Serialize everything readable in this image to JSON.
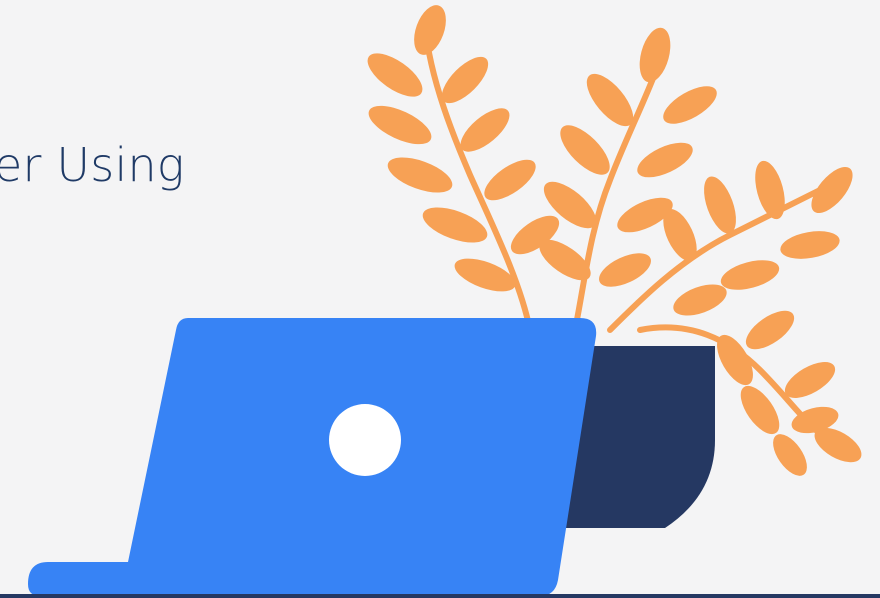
{
  "hero": {
    "heading_fragment": "er Using"
  },
  "colors": {
    "background": "#f4f4f5",
    "heading": "#1f3a66",
    "laptop": "#3783f5",
    "laptop_logo": "#ffffff",
    "plant": "#f7a155",
    "pot": "#253862",
    "floor_line": "#253862"
  },
  "icons": {
    "laptop": "laptop-illustration",
    "plant": "plant-illustration",
    "pot": "plant-pot-illustration"
  }
}
